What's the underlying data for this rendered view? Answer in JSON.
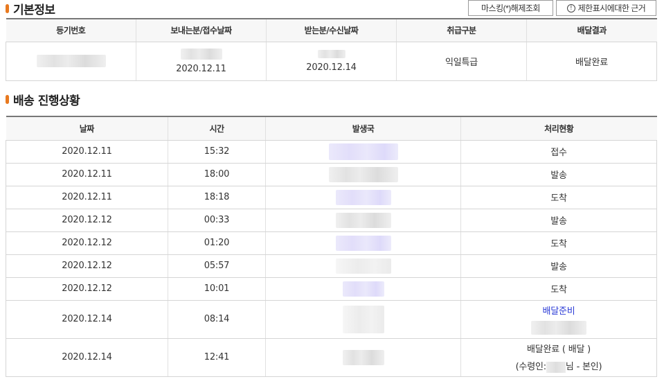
{
  "basic_info": {
    "title": "기본정보",
    "buttons": {
      "unmask": "마스킹(*)해제조회",
      "restriction_info": "제한표시에대한 근거",
      "restriction_icon": "info-circle-icon"
    },
    "columns": [
      "등기번호",
      "보내는분/접수날짜",
      "받는분/수신날짜",
      "취급구분",
      "배달결과"
    ],
    "row": {
      "send_date": "2020.12.11",
      "recv_date": "2020.12.14",
      "handling": "익일특급",
      "result": "배달완료"
    }
  },
  "progress": {
    "title": "배송 진행상황",
    "columns": [
      "날짜",
      "시간",
      "발생국",
      "처리현황"
    ],
    "rows": [
      {
        "date": "2020.12.11",
        "time": "15:32",
        "status": "접수"
      },
      {
        "date": "2020.12.11",
        "time": "18:00",
        "status": "발송"
      },
      {
        "date": "2020.12.11",
        "time": "18:18",
        "status": "도착"
      },
      {
        "date": "2020.12.12",
        "time": "00:33",
        "status": "발송"
      },
      {
        "date": "2020.12.12",
        "time": "01:20",
        "status": "도착"
      },
      {
        "date": "2020.12.12",
        "time": "05:57",
        "status": "발송"
      },
      {
        "date": "2020.12.12",
        "time": "10:01",
        "status": "도착"
      },
      {
        "date": "2020.12.14",
        "time": "08:14",
        "status": "배달준비"
      },
      {
        "date": "2020.12.14",
        "time": "12:41",
        "status": "배달완료 ( 배달 )",
        "receiver_prefix": "(수령인:",
        "receiver_suffix": "님 - 본인)"
      }
    ]
  },
  "colors": {
    "accent": "#e8791f",
    "link": "#2b3bd6"
  }
}
